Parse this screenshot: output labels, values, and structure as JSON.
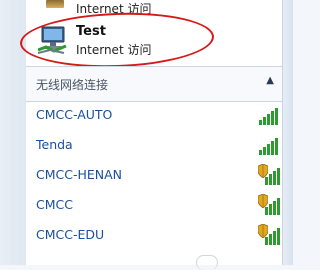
{
  "top_connection": {
    "sub": "Internet 访问"
  },
  "connected_network": {
    "name": "Test",
    "status": "Internet 访问"
  },
  "wireless_section": {
    "label": "无线网络连接"
  },
  "networks": [
    {
      "name": "CMCC-AUTO",
      "secured": false
    },
    {
      "name": "Tenda",
      "secured": false
    },
    {
      "name": "CMCC-HENAN",
      "secured": true
    },
    {
      "name": "CMCC",
      "secured": true
    },
    {
      "name": "CMCC-EDU",
      "secured": true
    }
  ],
  "colors": {
    "link": "#1a4f9e",
    "signal": "#2e9b2e",
    "annotation": "#d81818",
    "shield": "#e0a820"
  },
  "icons": {
    "signal": "signal-bars-icon",
    "shield": "security-shield-icon",
    "network": "network-monitor-icon",
    "collapse": "chevron-up-icon"
  }
}
